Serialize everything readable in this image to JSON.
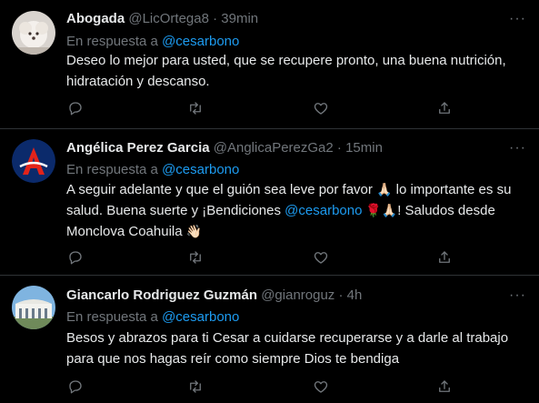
{
  "tweets": [
    {
      "name": "Abogada",
      "handle": "@LicOrtega8",
      "time": "39min",
      "reply_prefix": "En respuesta a",
      "reply_to": "@cesarbono",
      "text": "Deseo lo mejor para usted, que se recupere pronto, una buena nutrición, hidratación y descanso."
    },
    {
      "name": "Angélica Perez Garcia",
      "handle": "@AnglicaPerezGa2",
      "time": "15min",
      "reply_prefix": "En respuesta a",
      "reply_to": "@cesarbono",
      "text_part1": "A seguir adelante y que el guión sea leve por favor",
      "emoji1": "🙏🏻",
      "text_part2": " lo importante es su salud. Buena suerte y ¡Bendiciones ",
      "mention": "@cesarbono",
      "emoji2": " 🌹🙏🏻",
      "text_part3": "! Saludos desde Monclova Coahuila ",
      "emoji3": "👋🏻"
    },
    {
      "name": "Giancarlo Rodriguez Guzmán",
      "handle": "@gianroguz",
      "time": "4h",
      "reply_prefix": "En respuesta a",
      "reply_to": "@cesarbono",
      "text": "Besos y abrazos para ti Cesar a cuidarse recuperarse y a darle al trabajo para que nos hagas reír como siempre Dios te bendiga"
    }
  ],
  "separator": "·",
  "more_glyph": "···",
  "colors": {
    "background": "#000000",
    "text": "#e7e9ea",
    "muted": "#71767b",
    "link": "#1d9bf0",
    "divider": "#2f3336"
  },
  "icons": [
    "reply-icon",
    "retweet-icon",
    "like-icon",
    "share-icon",
    "more-icon"
  ]
}
